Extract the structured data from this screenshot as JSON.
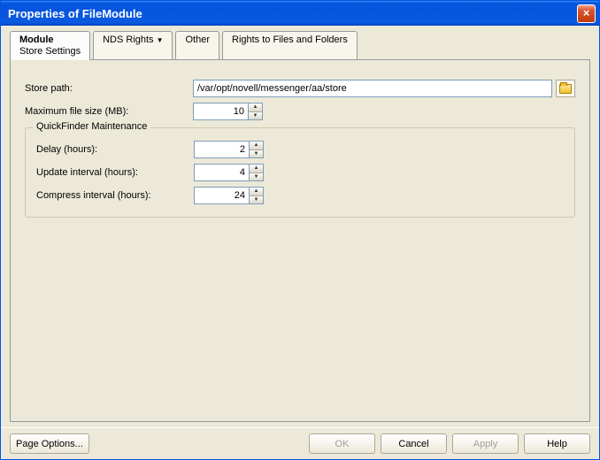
{
  "window": {
    "title": "Properties of FileModule"
  },
  "tabs": {
    "module_label": "Module",
    "module_sub": "Store Settings",
    "nds_label": "NDS Rights",
    "other_label": "Other",
    "rights_label": "Rights to Files and Folders"
  },
  "form": {
    "store_path_label": "Store path:",
    "store_path_value": "/var/opt/novell/messenger/aa/store",
    "max_size_label": "Maximum file size (MB):",
    "max_size_value": "10"
  },
  "group": {
    "legend": "QuickFinder Maintenance",
    "delay_label": "Delay (hours):",
    "delay_value": "2",
    "update_label": "Update interval (hours):",
    "update_value": "4",
    "compress_label": "Compress interval (hours):",
    "compress_value": "24"
  },
  "footer": {
    "page_options": "Page Options...",
    "ok": "OK",
    "cancel": "Cancel",
    "apply": "Apply",
    "help": "Help"
  }
}
